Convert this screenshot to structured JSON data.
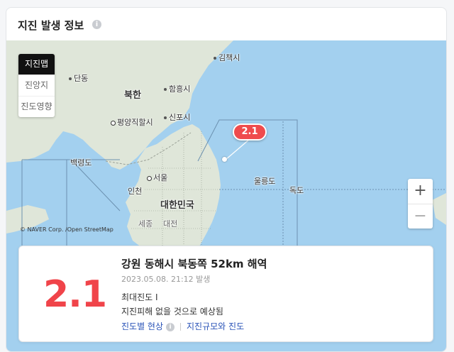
{
  "header": {
    "title": "지진 발생 정보",
    "info_icon": "i"
  },
  "map": {
    "modes": [
      {
        "label": "지진맵",
        "active": true
      },
      {
        "label": "진앙지",
        "active": false
      },
      {
        "label": "진도영향",
        "active": false
      }
    ],
    "labels": {
      "bukhan": "북한",
      "daehanminguk": "대한민국",
      "pyongyang": "평양직할시",
      "seoul": "서울",
      "incheon": "인천",
      "baengnyeongdo": "백령도",
      "dandong": "단동",
      "hamheung": "함흥시",
      "sinpo": "신포시",
      "gimchaek": "김책시",
      "ulleungdo": "울릉도",
      "dokdo": "독도",
      "sejong": "세종",
      "daejeon": "대전"
    },
    "marker_value": "2.1",
    "zoom_in": "+",
    "zoom_out": "−",
    "copyright": "© NAVER Corp. /Open StreetMap",
    "colors": {
      "sea": "#a3d0ef",
      "land": "#dfe6d9",
      "marker": "#ef4b4d"
    }
  },
  "quake": {
    "magnitude": "2.1",
    "location": "강원 동해시 북동쪽 52km 해역",
    "occurred": "2023.05.08. 21:12 발생",
    "max_intensity": "최대진도 Ⅰ",
    "damage": "지진피해 없을 것으로 예상됨",
    "link_phenomena": "진도별 현상",
    "link_scale": "지진규모와 진도",
    "colors": {
      "magnitude": "#f0444a",
      "link": "#2b54b8"
    }
  }
}
